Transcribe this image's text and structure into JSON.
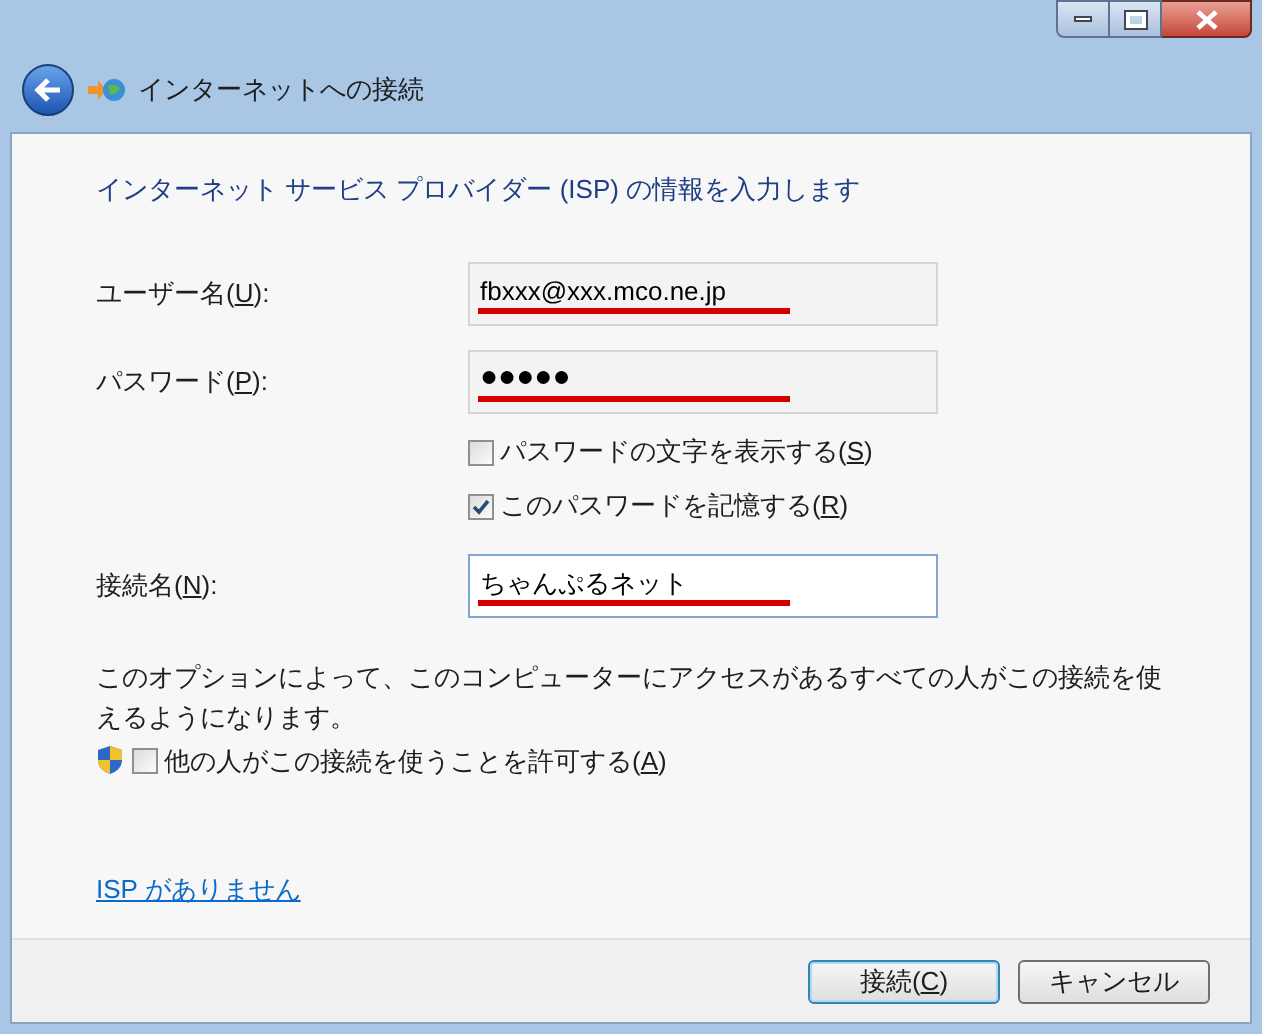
{
  "window": {
    "title": "インターネットへの接続"
  },
  "heading": "インターネット サービス プロバイダー (ISP) の情報を入力します",
  "fields": [
    {
      "label_before": "ユーザー名(",
      "access_key": "U",
      "label_after": "):",
      "value": "fbxxx@xxx.mco.ne.jp",
      "underlined": true,
      "focused": false,
      "kind": "text"
    },
    {
      "label_before": "パスワード(",
      "access_key": "P",
      "label_after": "):",
      "value": "●●●●●",
      "underlined": true,
      "focused": false,
      "kind": "password"
    },
    {
      "kind": "checkbox",
      "label_before": "パスワードの文字を表示する(",
      "access_key": "S",
      "label_after": ")",
      "checked": false
    },
    {
      "kind": "checkbox",
      "label_before": "このパスワードを記憶する(",
      "access_key": "R",
      "label_after": ")",
      "checked": true
    },
    {
      "label_before": "接続名(",
      "access_key": "N",
      "label_after": "):",
      "value": "ちゃんぷるネット",
      "underlined": true,
      "focused": true,
      "kind": "text"
    }
  ],
  "note": "このオプションによって、このコンピューターにアクセスがあるすべての人がこの接続を使えるようになります。",
  "allow_others": {
    "label_before": "他の人がこの接続を使うことを許可する(",
    "access_key": "A",
    "label_after": ")",
    "checked": false
  },
  "link": "ISP がありません",
  "buttons": [
    {
      "label_before": "接続(",
      "access_key": "C",
      "label_after": ")",
      "default": true
    },
    {
      "label_before": "キャンセル",
      "default": false
    }
  ]
}
